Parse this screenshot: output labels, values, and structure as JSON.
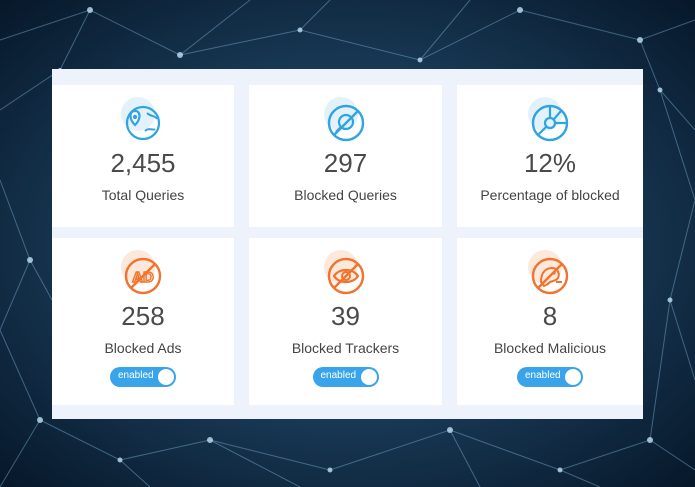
{
  "colors": {
    "blue_accent": "#2fa4e0",
    "orange_accent": "#f2732e",
    "toggle": "#3aa4ea"
  },
  "stats": [
    {
      "icon": "globe-pin-icon",
      "value": "2,455",
      "label": "Total Queries"
    },
    {
      "icon": "blocked-search-icon",
      "value": "297",
      "label": "Blocked Queries"
    },
    {
      "icon": "pie-chart-icon",
      "value": "12%",
      "label": "Percentage of blocked"
    }
  ],
  "blockers": [
    {
      "icon": "blocked-ad-icon",
      "value": "258",
      "label": "Blocked Ads",
      "toggle": "enabled"
    },
    {
      "icon": "blocked-tracker-icon",
      "value": "39",
      "label": "Blocked Trackers",
      "toggle": "enabled"
    },
    {
      "icon": "blocked-malicious-icon",
      "value": "8",
      "label": "Blocked Malicious",
      "toggle": "enabled"
    }
  ]
}
